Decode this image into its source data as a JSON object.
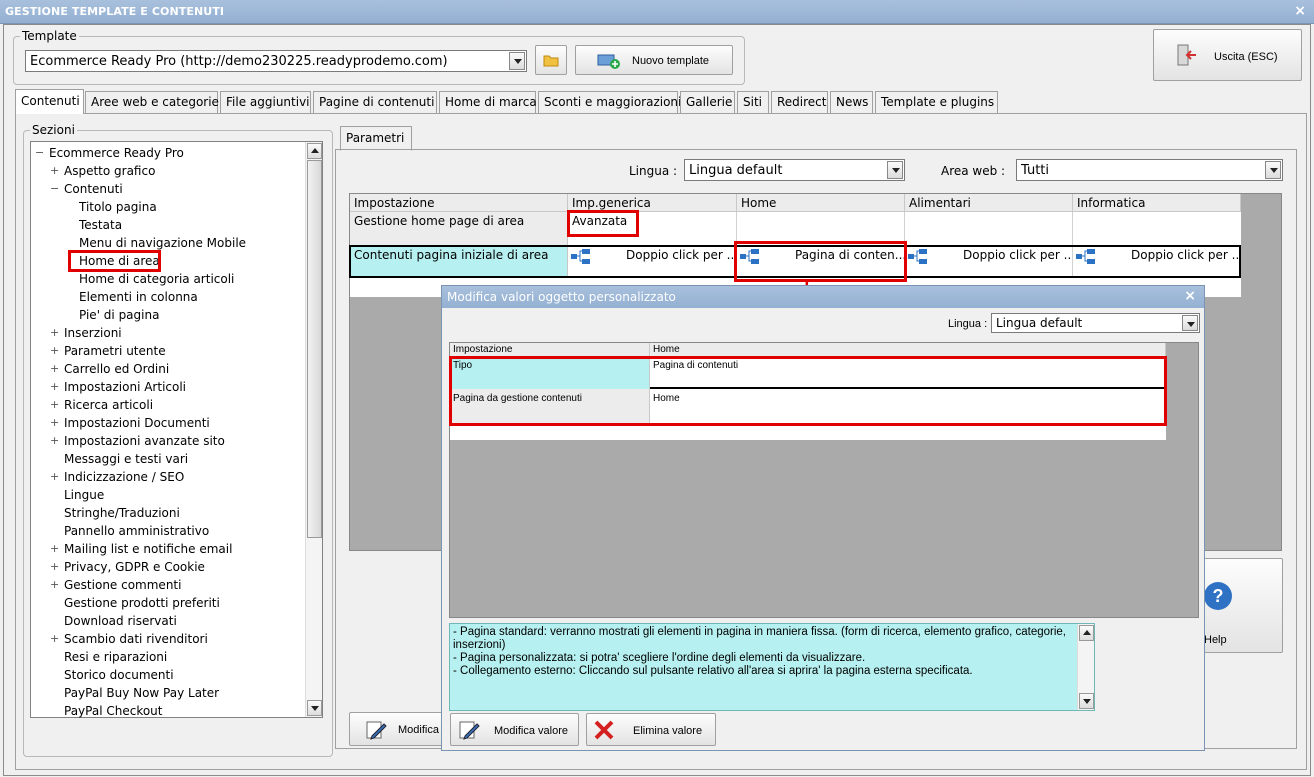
{
  "window": {
    "title": "GESTIONE TEMPLATE E CONTENUTI",
    "close": "×"
  },
  "template": {
    "legend": "Template",
    "selected": "Ecommerce Ready Pro (http://demo230225.readyprodemo.com)",
    "new_button": "Nuovo template"
  },
  "exit_button": "Uscita (ESC)",
  "tabs": [
    "Contenuti",
    "Aree web e categorie",
    "File aggiuntivi",
    "Pagine di contenuti",
    "Home di marca",
    "Sconti e maggiorazioni",
    "Gallerie",
    "Siti",
    "Redirect",
    "News",
    "Template e plugins"
  ],
  "sections": {
    "legend": "Sezioni",
    "items": [
      {
        "label": "Ecommerce Ready Pro",
        "level": 0,
        "exp": "−"
      },
      {
        "label": "Aspetto grafico",
        "level": 1,
        "exp": "+"
      },
      {
        "label": "Contenuti",
        "level": 1,
        "exp": "−"
      },
      {
        "label": "Titolo pagina",
        "level": 2,
        "exp": ""
      },
      {
        "label": "Testata",
        "level": 2,
        "exp": ""
      },
      {
        "label": "Menu di navigazione Mobile",
        "level": 2,
        "exp": ""
      },
      {
        "label": "Home di area",
        "level": 2,
        "exp": ""
      },
      {
        "label": "Home di categoria articoli",
        "level": 2,
        "exp": ""
      },
      {
        "label": "Elementi in colonna",
        "level": 2,
        "exp": ""
      },
      {
        "label": "Pie' di pagina",
        "level": 2,
        "exp": ""
      },
      {
        "label": "Inserzioni",
        "level": 1,
        "exp": "+"
      },
      {
        "label": "Parametri utente",
        "level": 1,
        "exp": "+"
      },
      {
        "label": "Carrello ed Ordini",
        "level": 1,
        "exp": "+"
      },
      {
        "label": "Impostazioni Articoli",
        "level": 1,
        "exp": "+"
      },
      {
        "label": "Ricerca articoli",
        "level": 1,
        "exp": "+"
      },
      {
        "label": "Impostazioni Documenti",
        "level": 1,
        "exp": "+"
      },
      {
        "label": "Impostazioni avanzate sito",
        "level": 1,
        "exp": "+"
      },
      {
        "label": "Messaggi e testi vari",
        "level": 1,
        "exp": ""
      },
      {
        "label": "Indicizzazione / SEO",
        "level": 1,
        "exp": "+"
      },
      {
        "label": "Lingue",
        "level": 1,
        "exp": ""
      },
      {
        "label": "Stringhe/Traduzioni",
        "level": 1,
        "exp": ""
      },
      {
        "label": "Pannello amministrativo",
        "level": 1,
        "exp": ""
      },
      {
        "label": "Mailing list e notifiche email",
        "level": 1,
        "exp": "+"
      },
      {
        "label": "Privacy, GDPR e Cookie",
        "level": 1,
        "exp": "+"
      },
      {
        "label": "Gestione commenti",
        "level": 1,
        "exp": "+"
      },
      {
        "label": "Gestione prodotti preferiti",
        "level": 1,
        "exp": ""
      },
      {
        "label": "Download riservati",
        "level": 1,
        "exp": ""
      },
      {
        "label": "Scambio dati rivenditori",
        "level": 1,
        "exp": "+"
      },
      {
        "label": "Resi e riparazioni",
        "level": 1,
        "exp": ""
      },
      {
        "label": "Storico documenti",
        "level": 1,
        "exp": ""
      },
      {
        "label": "PayPal Buy Now Pay Later",
        "level": 1,
        "exp": ""
      },
      {
        "label": "PayPal Checkout",
        "level": 1,
        "exp": ""
      }
    ]
  },
  "params": {
    "tab": "Parametri",
    "lingua_label": "Lingua :",
    "lingua_value": "Lingua default",
    "area_label": "Area web :",
    "area_value": "Tutti",
    "columns": [
      "Impostazione",
      "Imp.generica",
      "Home",
      "Alimentari",
      "Informatica"
    ],
    "rows": [
      {
        "name": "Gestione home page di area",
        "cells": [
          "Avanzata",
          "",
          "",
          ""
        ]
      },
      {
        "name": "Contenuti pagina iniziale di area",
        "cells": [
          "Doppio click per ...",
          "Pagina di conten...",
          "Doppio click per ...",
          "Doppio click per ..."
        ]
      }
    ],
    "modify_button": "Modifica",
    "help_label": "Help",
    "help_icon": "?"
  },
  "dialog": {
    "title": "Modifica valori oggetto personalizzato",
    "close": "×",
    "lingua_label": "Lingua :",
    "lingua_value": "Lingua default",
    "columns": [
      "Impostazione",
      "Home"
    ],
    "rows": [
      {
        "name": "Tipo",
        "value": "Pagina di contenuti"
      },
      {
        "name": "Pagina da gestione contenuti",
        "value": "Home"
      }
    ],
    "info": [
      "- Pagina standard: verranno mostrati gli elementi in pagina in maniera fissa. (form di ricerca, elemento grafico, categorie, inserzioni)",
      "- Pagina personalizzata: si potra' scegliere l'ordine degli elementi da visualizzare.",
      "- Collegamento esterno: Cliccando sul pulsante relativo all'area si aprira' la pagina esterna specificata."
    ],
    "modify_button": "Modifica valore",
    "delete_button": "Elimina valore"
  },
  "colors": {
    "highlight": "#b7f0f0",
    "accent_red": "#e00000",
    "title_blue": "#9fb8d8"
  }
}
